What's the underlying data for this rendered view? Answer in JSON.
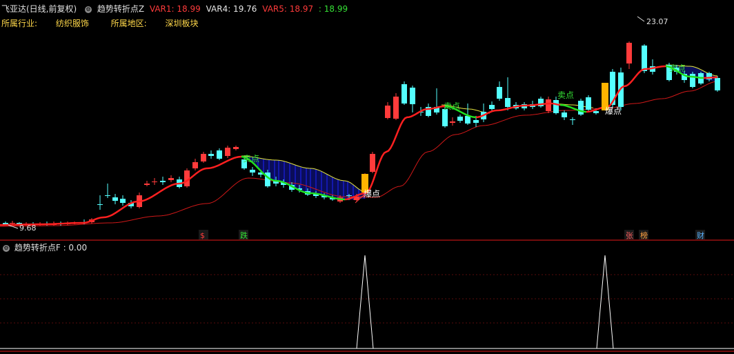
{
  "header": {
    "stock_name": "飞亚达(日线,前复权)",
    "indicator_name": "趋势转折点Z",
    "values": [
      {
        "label": "VAR1: 18.99",
        "color": "#ff3b3b"
      },
      {
        "label": "VAR4: 19.76",
        "color": "#e8e8e8"
      },
      {
        "label": "VAR5: 18.97",
        "color": "#ff3b3b"
      },
      {
        "label": ": 18.99",
        "color": "#35e035"
      }
    ]
  },
  "info": {
    "industry_label": "所属行业:",
    "industry_value": "纺织服饰",
    "region_label": "所属地区:",
    "region_value": "深圳板块"
  },
  "price_chart": {
    "high_label": "23.07",
    "low_label": "9.68",
    "sell_labels": [
      "卖点",
      "卖点",
      "卖点",
      "卖点"
    ],
    "burst_labels": [
      "爆点",
      "爆点"
    ],
    "bottom_tags": [
      {
        "text": "$",
        "color": "#ff3b3b"
      },
      {
        "text": "跌",
        "color": "#35e035"
      },
      {
        "text": "张",
        "color": "#ff6060"
      },
      {
        "text": "榜",
        "color": "#ffa040"
      },
      {
        "text": "财",
        "color": "#5ab4ff"
      }
    ]
  },
  "sub_chart": {
    "indicator_name": "趋势转折点F",
    "value_label": ": 0.00"
  },
  "colors": {
    "up": "#ff3b3b",
    "down": "#54ffff",
    "ma_fast_up": "#ff2020",
    "ma_fast_down": "#20e020",
    "ma_slow": "#d01818",
    "upper": "#e8e840",
    "fill": "#1c24ff",
    "burst": "#ffb400"
  }
}
